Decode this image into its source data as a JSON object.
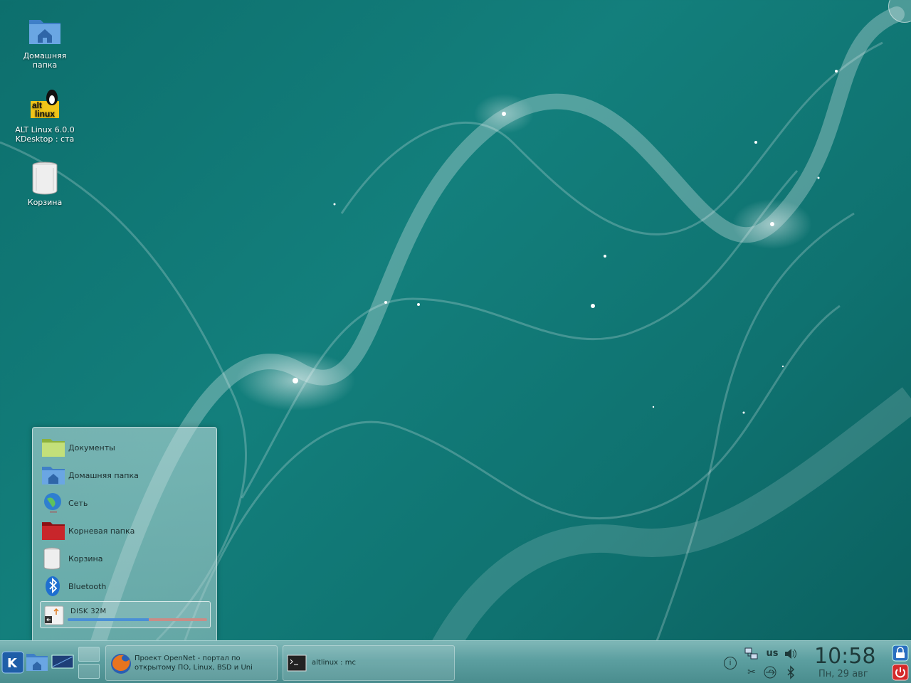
{
  "desktop": {
    "icons": [
      {
        "label": "Домашняя\nпапка",
        "icon": "home-folder-icon"
      },
      {
        "label": "ALT Linux 6.0.0\nKDesktop : ста",
        "icon": "alt-linux-logo"
      },
      {
        "label": "Корзина",
        "icon": "trash-icon"
      }
    ]
  },
  "folder_popup": {
    "items": [
      {
        "label": "Документы",
        "icon": "documents-folder-icon"
      },
      {
        "label": "Домашняя папка",
        "icon": "home-folder-icon"
      },
      {
        "label": "Сеть",
        "icon": "network-globe-icon"
      },
      {
        "label": "Корневая папка",
        "icon": "root-folder-icon"
      },
      {
        "label": "Корзина",
        "icon": "trash-icon"
      },
      {
        "label": "Bluetooth",
        "icon": "bluetooth-icon"
      }
    ],
    "disk": {
      "label": "DISK  32M",
      "icon": "usb-drive-icon",
      "usage_fraction": 0.58
    }
  },
  "taskbar": {
    "tasks": [
      {
        "label": "Проект OpenNet - портал по\nоткрытому ПО, Linux, BSD и Uni",
        "icon": "firefox-icon"
      },
      {
        "label": "altlinux : mc",
        "icon": "terminal-icon"
      }
    ],
    "keyboard_layout": "us",
    "clock": {
      "time": "10:58",
      "date": "Пн, 29 авг"
    }
  },
  "colors": {
    "wallpaper": "#137f7c",
    "taskbar": "#5c9fa0",
    "accent": "#4a8fd6"
  }
}
